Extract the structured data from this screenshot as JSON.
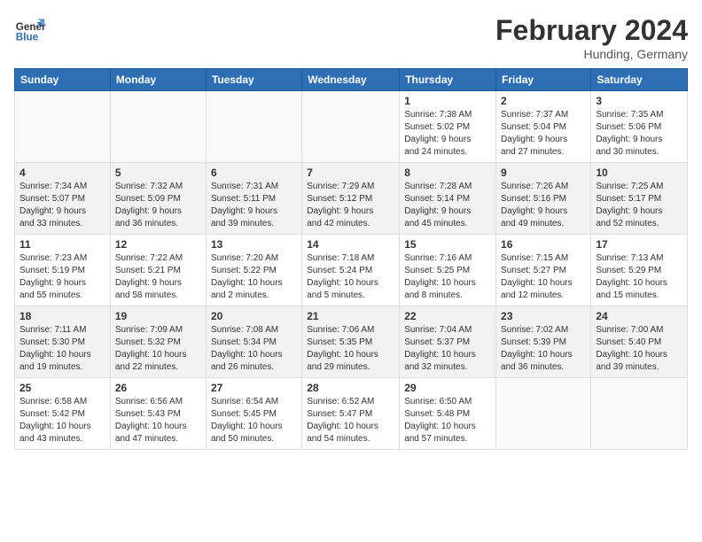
{
  "header": {
    "logo_general": "General",
    "logo_blue": "Blue",
    "month_title": "February 2024",
    "location": "Hunding, Germany"
  },
  "days_of_week": [
    "Sunday",
    "Monday",
    "Tuesday",
    "Wednesday",
    "Thursday",
    "Friday",
    "Saturday"
  ],
  "weeks": [
    [
      {
        "day": "",
        "info": ""
      },
      {
        "day": "",
        "info": ""
      },
      {
        "day": "",
        "info": ""
      },
      {
        "day": "",
        "info": ""
      },
      {
        "day": "1",
        "info": "Sunrise: 7:38 AM\nSunset: 5:02 PM\nDaylight: 9 hours\nand 24 minutes."
      },
      {
        "day": "2",
        "info": "Sunrise: 7:37 AM\nSunset: 5:04 PM\nDaylight: 9 hours\nand 27 minutes."
      },
      {
        "day": "3",
        "info": "Sunrise: 7:35 AM\nSunset: 5:06 PM\nDaylight: 9 hours\nand 30 minutes."
      }
    ],
    [
      {
        "day": "4",
        "info": "Sunrise: 7:34 AM\nSunset: 5:07 PM\nDaylight: 9 hours\nand 33 minutes."
      },
      {
        "day": "5",
        "info": "Sunrise: 7:32 AM\nSunset: 5:09 PM\nDaylight: 9 hours\nand 36 minutes."
      },
      {
        "day": "6",
        "info": "Sunrise: 7:31 AM\nSunset: 5:11 PM\nDaylight: 9 hours\nand 39 minutes."
      },
      {
        "day": "7",
        "info": "Sunrise: 7:29 AM\nSunset: 5:12 PM\nDaylight: 9 hours\nand 42 minutes."
      },
      {
        "day": "8",
        "info": "Sunrise: 7:28 AM\nSunset: 5:14 PM\nDaylight: 9 hours\nand 45 minutes."
      },
      {
        "day": "9",
        "info": "Sunrise: 7:26 AM\nSunset: 5:16 PM\nDaylight: 9 hours\nand 49 minutes."
      },
      {
        "day": "10",
        "info": "Sunrise: 7:25 AM\nSunset: 5:17 PM\nDaylight: 9 hours\nand 52 minutes."
      }
    ],
    [
      {
        "day": "11",
        "info": "Sunrise: 7:23 AM\nSunset: 5:19 PM\nDaylight: 9 hours\nand 55 minutes."
      },
      {
        "day": "12",
        "info": "Sunrise: 7:22 AM\nSunset: 5:21 PM\nDaylight: 9 hours\nand 58 minutes."
      },
      {
        "day": "13",
        "info": "Sunrise: 7:20 AM\nSunset: 5:22 PM\nDaylight: 10 hours\nand 2 minutes."
      },
      {
        "day": "14",
        "info": "Sunrise: 7:18 AM\nSunset: 5:24 PM\nDaylight: 10 hours\nand 5 minutes."
      },
      {
        "day": "15",
        "info": "Sunrise: 7:16 AM\nSunset: 5:25 PM\nDaylight: 10 hours\nand 8 minutes."
      },
      {
        "day": "16",
        "info": "Sunrise: 7:15 AM\nSunset: 5:27 PM\nDaylight: 10 hours\nand 12 minutes."
      },
      {
        "day": "17",
        "info": "Sunrise: 7:13 AM\nSunset: 5:29 PM\nDaylight: 10 hours\nand 15 minutes."
      }
    ],
    [
      {
        "day": "18",
        "info": "Sunrise: 7:11 AM\nSunset: 5:30 PM\nDaylight: 10 hours\nand 19 minutes."
      },
      {
        "day": "19",
        "info": "Sunrise: 7:09 AM\nSunset: 5:32 PM\nDaylight: 10 hours\nand 22 minutes."
      },
      {
        "day": "20",
        "info": "Sunrise: 7:08 AM\nSunset: 5:34 PM\nDaylight: 10 hours\nand 26 minutes."
      },
      {
        "day": "21",
        "info": "Sunrise: 7:06 AM\nSunset: 5:35 PM\nDaylight: 10 hours\nand 29 minutes."
      },
      {
        "day": "22",
        "info": "Sunrise: 7:04 AM\nSunset: 5:37 PM\nDaylight: 10 hours\nand 32 minutes."
      },
      {
        "day": "23",
        "info": "Sunrise: 7:02 AM\nSunset: 5:39 PM\nDaylight: 10 hours\nand 36 minutes."
      },
      {
        "day": "24",
        "info": "Sunrise: 7:00 AM\nSunset: 5:40 PM\nDaylight: 10 hours\nand 39 minutes."
      }
    ],
    [
      {
        "day": "25",
        "info": "Sunrise: 6:58 AM\nSunset: 5:42 PM\nDaylight: 10 hours\nand 43 minutes."
      },
      {
        "day": "26",
        "info": "Sunrise: 6:56 AM\nSunset: 5:43 PM\nDaylight: 10 hours\nand 47 minutes."
      },
      {
        "day": "27",
        "info": "Sunrise: 6:54 AM\nSunset: 5:45 PM\nDaylight: 10 hours\nand 50 minutes."
      },
      {
        "day": "28",
        "info": "Sunrise: 6:52 AM\nSunset: 5:47 PM\nDaylight: 10 hours\nand 54 minutes."
      },
      {
        "day": "29",
        "info": "Sunrise: 6:50 AM\nSunset: 5:48 PM\nDaylight: 10 hours\nand 57 minutes."
      },
      {
        "day": "",
        "info": ""
      },
      {
        "day": "",
        "info": ""
      }
    ]
  ]
}
